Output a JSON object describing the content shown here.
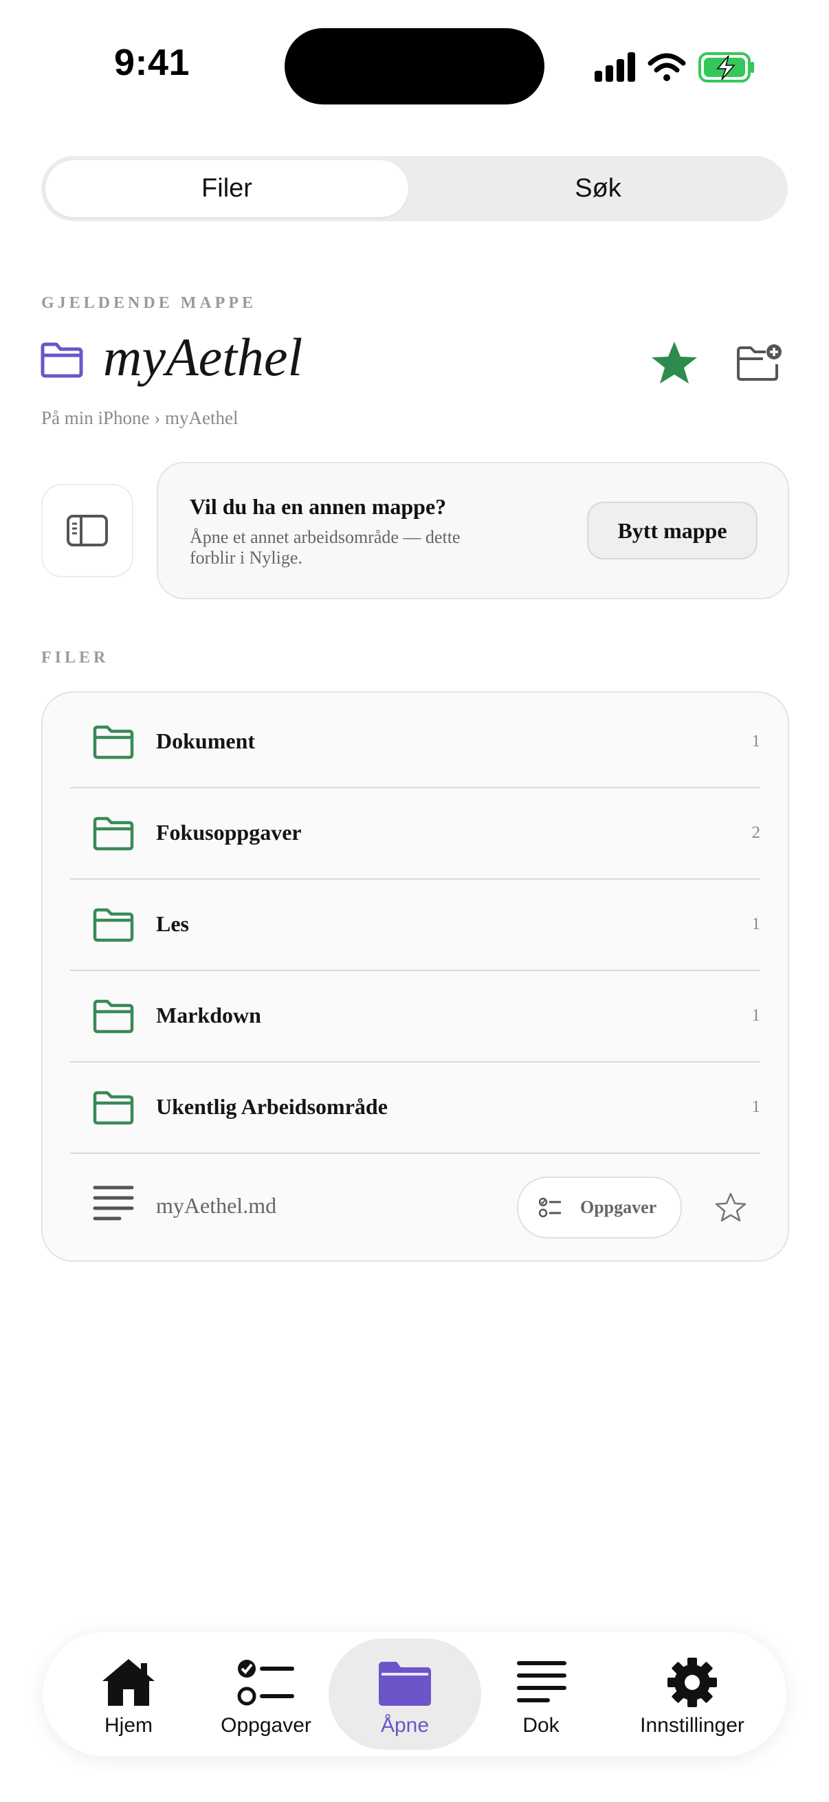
{
  "status_bar": {
    "time": "9:41"
  },
  "segmented": {
    "files": "Filer",
    "search": "Søk"
  },
  "current_folder": {
    "section_label": "GJELDENDE MAPPE",
    "name": "myAethel",
    "breadcrumb": "På min iPhone › myAethel"
  },
  "switch_card": {
    "title": "Vil du ha en annen mappe?",
    "description": "Åpne et annet arbeidsområde — dette forblir i Nylige.",
    "button": "Bytt mappe"
  },
  "files": {
    "section_label": "FILER",
    "folders": [
      {
        "name": "Dokument",
        "count": "1"
      },
      {
        "name": "Fokusoppgaver",
        "count": "2"
      },
      {
        "name": "Les",
        "count": "1"
      },
      {
        "name": "Markdown",
        "count": "1"
      },
      {
        "name": "Ukentlig Arbeidsområde",
        "count": "1"
      }
    ],
    "document": {
      "name": "myAethel.md",
      "tasks_button": "Oppgaver"
    }
  },
  "tabbar": {
    "home": "Hjem",
    "tasks": "Oppgaver",
    "open": "Åpne",
    "doc": "Dok",
    "settings": "Innstillinger"
  },
  "colors": {
    "accent": "#6b55c8",
    "folder_green": "#3a8a55",
    "star_green": "#2e8b4e",
    "battery_green": "#34c759"
  },
  "icons": [
    "signal-icon",
    "wifi-icon",
    "battery-charging-icon",
    "folder-icon",
    "star-icon",
    "new-folder-icon",
    "sidebar-icon",
    "document-lines-icon",
    "checklist-icon",
    "home-icon",
    "gear-icon"
  ]
}
